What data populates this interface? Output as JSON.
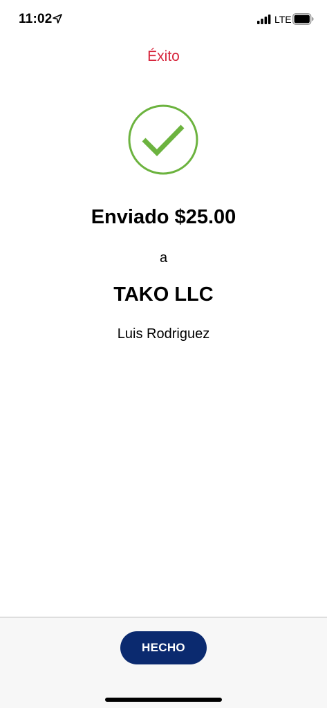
{
  "status_bar": {
    "time": "11:02",
    "network": "LTE"
  },
  "header": {
    "title": "Éxito"
  },
  "confirmation": {
    "amount_text": "Enviado $25.00",
    "preposition": "a",
    "recipient_name": "TAKO LLC",
    "recipient_person": "Luis Rodriguez"
  },
  "footer": {
    "done_label": "HECHO"
  },
  "colors": {
    "title": "#d7263d",
    "check": "#6cb33f",
    "button": "#0b2a6f"
  },
  "icons": [
    "location-arrow-icon",
    "cellular-signal-icon",
    "battery-icon",
    "checkmark-circle-icon"
  ]
}
